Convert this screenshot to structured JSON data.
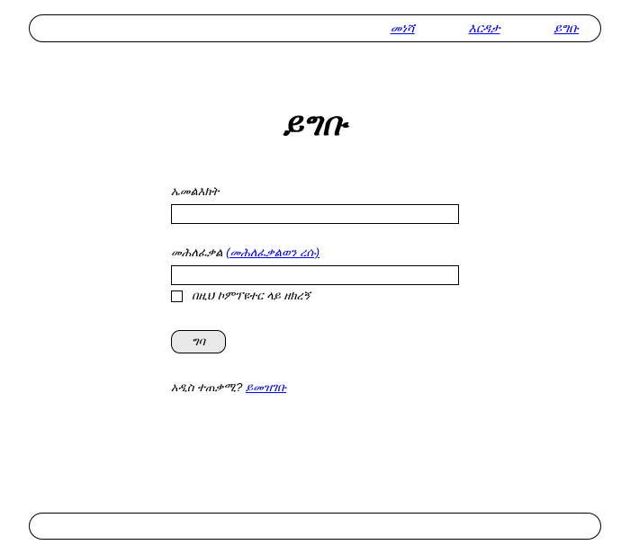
{
  "nav": {
    "home": "መነሻ",
    "help": "እርዳታ",
    "login": "ይግቡ"
  },
  "page": {
    "title": "ይግቡ"
  },
  "form": {
    "email_label": "ኤመልእክት",
    "email_value": "",
    "password_label": "መሕለፈቃል ",
    "forgot_password": "(መሕለፈቃልወን ረሱ)",
    "password_value": "",
    "remember_label": "በዚህ ኮምፕዩተር ላይ ዘክረኝ",
    "submit_label": "ግባ"
  },
  "register": {
    "prompt": "አዲስ ተጠቃሚ? ",
    "link": "ይመዝገቡ"
  }
}
